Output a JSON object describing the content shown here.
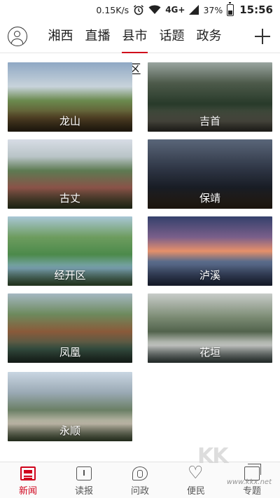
{
  "status_bar": {
    "net_speed": "0.15K/s",
    "network": "4G+",
    "battery": "37%",
    "battery_level": 0.37,
    "time": "15:56"
  },
  "top_nav": {
    "tabs": [
      {
        "label": "湘西"
      },
      {
        "label": "直播"
      },
      {
        "label": "县市区"
      },
      {
        "label": "话题"
      },
      {
        "label": "政务"
      }
    ],
    "active_tab": "县市区"
  },
  "regions": [
    {
      "label": "龙山"
    },
    {
      "label": "吉首"
    },
    {
      "label": "古丈"
    },
    {
      "label": "保靖"
    },
    {
      "label": "经开区"
    },
    {
      "label": "泸溪"
    },
    {
      "label": "凤凰"
    },
    {
      "label": "花垣"
    },
    {
      "label": "永顺"
    }
  ],
  "bottom_bar": {
    "items": [
      {
        "label": "新闻"
      },
      {
        "label": "读报"
      },
      {
        "label": "问政"
      },
      {
        "label": "便民"
      },
      {
        "label": "专题"
      }
    ]
  },
  "watermark": {
    "text": "www.kkx.net"
  }
}
